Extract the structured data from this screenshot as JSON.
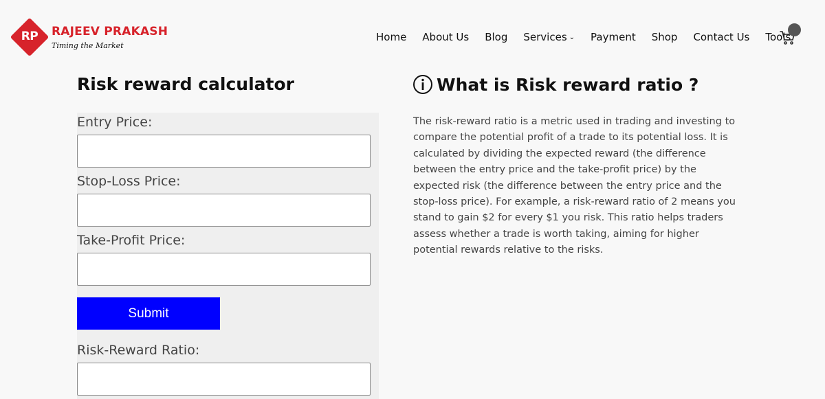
{
  "brand": {
    "logo_initials": "RP",
    "name": "RAJEEV PRAKASH",
    "tagline": "Timing the Market",
    "color": "#d7232b"
  },
  "nav": {
    "items": [
      {
        "label": "Home"
      },
      {
        "label": "About Us"
      },
      {
        "label": "Blog"
      },
      {
        "label": "Services",
        "has_dropdown": true
      },
      {
        "label": "Payment"
      },
      {
        "label": "Shop"
      },
      {
        "label": "Contact Us"
      },
      {
        "label": "Tools"
      }
    ],
    "cart_icon": "cart-icon"
  },
  "calculator": {
    "title": "Risk reward calculator",
    "entry_label": "Entry Price:",
    "entry_value": "",
    "stoploss_label": "Stop-Loss Price:",
    "stoploss_value": "",
    "takeprofit_label": "Take-Profit Price:",
    "takeprofit_value": "",
    "submit_label": "Submit",
    "submit_color": "#0000ff",
    "result_label": "Risk-Reward Ratio:",
    "result_value": ""
  },
  "info": {
    "icon": "info-icon",
    "title": "What is Risk reward ratio ?",
    "body": "The risk-reward ratio is a metric used in trading and investing to compare the potential profit of a trade to its potential loss. It is calculated by dividing the expected reward (the difference between the entry price and the take-profit price) by the expected risk (the difference between the entry price and the stop-loss price). For example, a risk-reward ratio of 2 means you stand to gain $2 for every $1 you risk. This ratio helps traders assess whether a trade is worth taking, aiming for higher potential rewards relative to the risks."
  }
}
